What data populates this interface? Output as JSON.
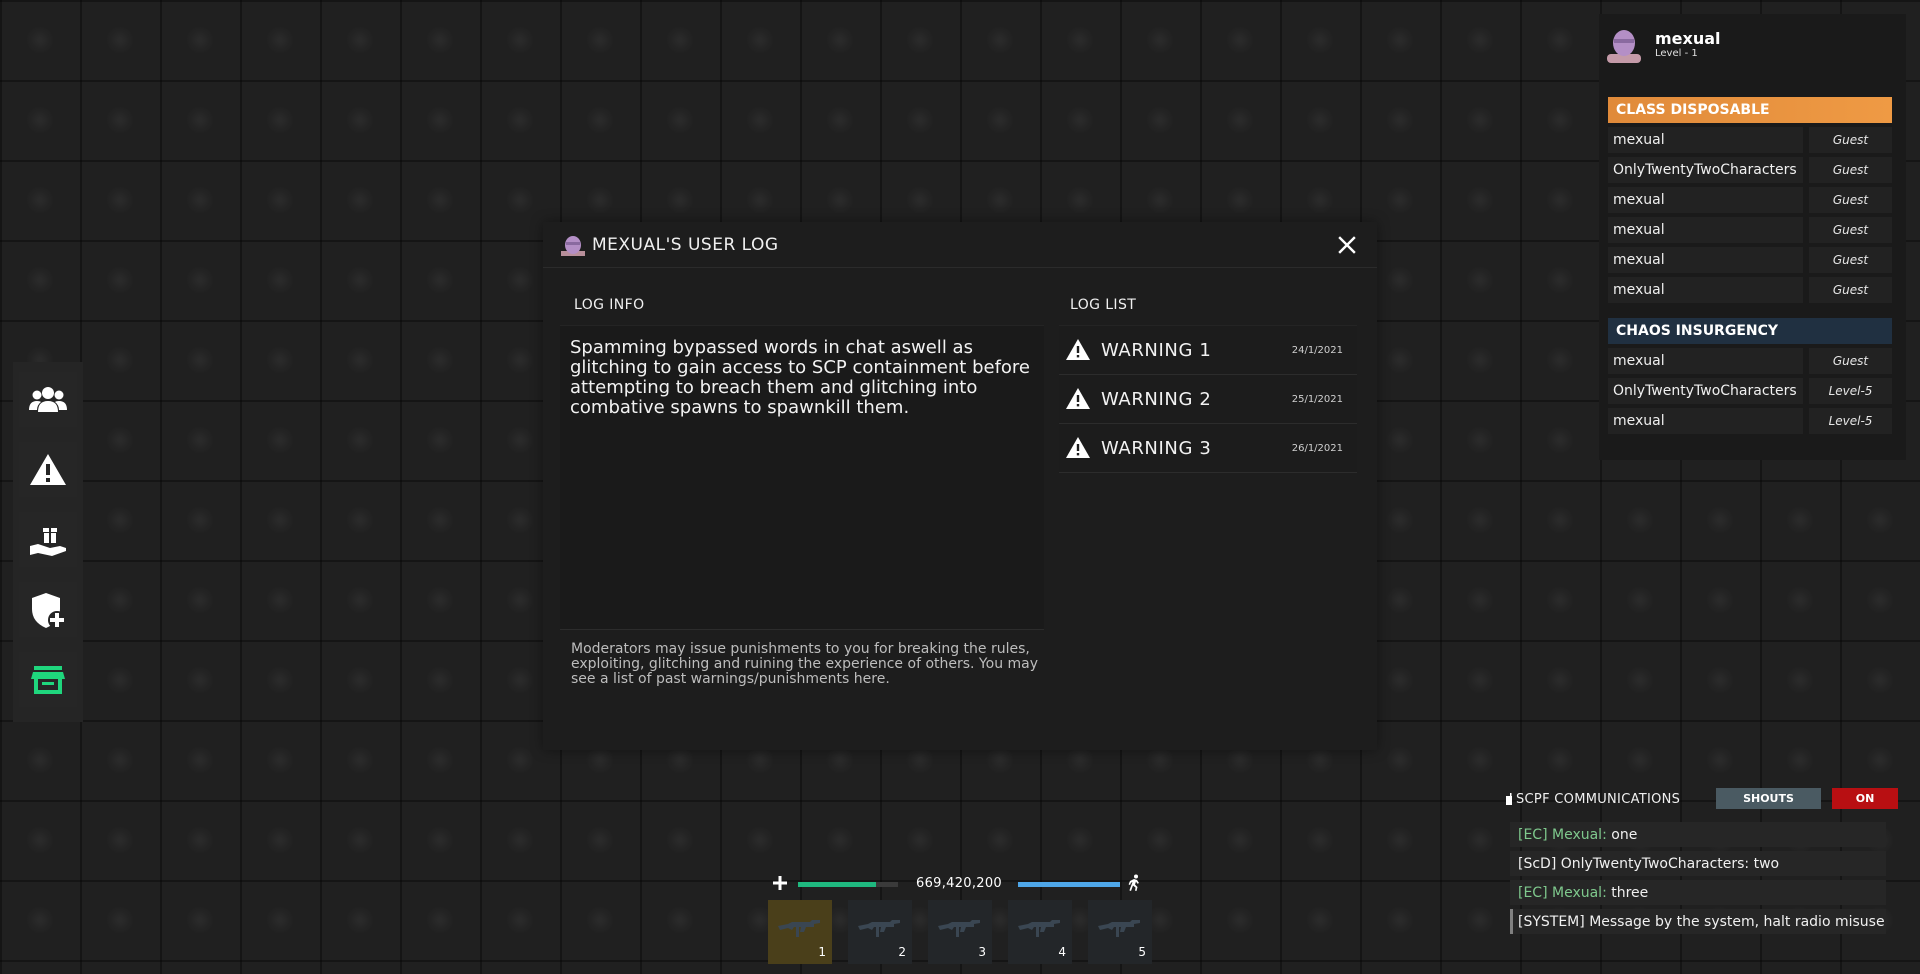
{
  "sidebar": {
    "items": [
      {
        "name": "users-icon"
      },
      {
        "name": "warning-icon"
      },
      {
        "name": "gift-icon"
      },
      {
        "name": "shield-plus-icon"
      },
      {
        "name": "store-icon",
        "color": "#1fd67d"
      }
    ]
  },
  "modal": {
    "title": "MEXUAL'S USER LOG",
    "log_info_heading": "LOG INFO",
    "log_list_heading": "LOG LIST",
    "info_text": "Spamming bypassed words in chat aswell as glitching to gain access to SCP containment before attempting to breach them and glitching into combative spawns to spawnkill them.",
    "footer_text": "Moderators may issue punishments to you for breaking the rules, exploiting, glitching and ruining the experience of others. You may see a list of past warnings/punishments here.",
    "logs": [
      {
        "title": "WARNING 1",
        "date": "24/1/2021"
      },
      {
        "title": "WARNING 2",
        "date": "25/1/2021"
      },
      {
        "title": "WARNING 3",
        "date": "26/1/2021"
      }
    ]
  },
  "player": {
    "name": "mexual",
    "level": "Level - 1"
  },
  "teams": [
    {
      "name": "CLASS DISPOSABLE",
      "color": "#ef9a44",
      "members": [
        {
          "name": "mexual",
          "rank": "Guest"
        },
        {
          "name": "OnlyTwentyTwoCharacters",
          "rank": "Guest"
        },
        {
          "name": "mexual",
          "rank": "Guest"
        },
        {
          "name": "mexual",
          "rank": "Guest"
        },
        {
          "name": "mexual",
          "rank": "Guest"
        },
        {
          "name": "mexual",
          "rank": "Guest"
        }
      ]
    },
    {
      "name": "CHAOS INSURGENCY",
      "color": "#203041",
      "members": [
        {
          "name": "mexual",
          "rank": "Guest"
        },
        {
          "name": "OnlyTwentyTwoCharacters",
          "rank": "Level-5"
        },
        {
          "name": "mexual",
          "rank": "Level-5"
        }
      ]
    }
  ],
  "comms": {
    "title": "SCPF COMMUNICATIONS",
    "shouts_label": "SHOUTS",
    "toggle_label": "ON",
    "messages": [
      {
        "tag": "[EC] Mexual:",
        "text": "one",
        "tag_color": "#7fc98d"
      },
      {
        "tag": "[ScD] OnlyTwentyTwoCharacters:",
        "text": "two",
        "tag_color": "#f0f0f0"
      },
      {
        "tag": "[EC] Mexual:",
        "text": "three",
        "tag_color": "#7fc98d"
      },
      {
        "tag": "[SYSTEM]",
        "text": "Message by the system, halt radio misuse!",
        "tag_color": "#f0f0f0"
      }
    ]
  },
  "hud": {
    "money": "669,420,200",
    "health_fraction": 0.78,
    "stamina_fraction": 1.0,
    "slots": [
      "1",
      "2",
      "3",
      "4",
      "5"
    ],
    "active_slot": 0
  }
}
